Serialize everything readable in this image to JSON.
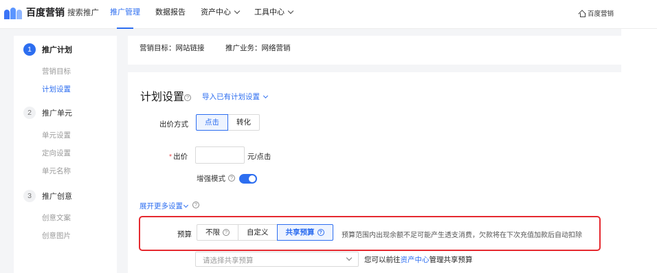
{
  "brand": {
    "name": "百度营销",
    "sub": "搜索推广"
  },
  "nav": {
    "items": [
      {
        "label": "推广管理",
        "active": true,
        "dropdown": false
      },
      {
        "label": "数据报告",
        "active": false,
        "dropdown": false
      },
      {
        "label": "资产中心",
        "active": false,
        "dropdown": true
      },
      {
        "label": "工具中心",
        "active": false,
        "dropdown": true
      }
    ],
    "home_label": "百度营销"
  },
  "steps": [
    {
      "num": "1",
      "title": "推广计划",
      "active": true,
      "subs": [
        "营销目标",
        "计划设置"
      ],
      "current_sub": "计划设置"
    },
    {
      "num": "2",
      "title": "推广单元",
      "active": false,
      "subs": [
        "单元设置",
        "定向设置",
        "单元名称"
      ]
    },
    {
      "num": "3",
      "title": "推广创意",
      "active": false,
      "subs": [
        "创意文案",
        "创意图片"
      ]
    }
  ],
  "summary": {
    "target": "营销目标：网站链接",
    "business": "推广业务：网络营销"
  },
  "plan": {
    "title": "计划设置",
    "import_link": "导入已有计划设置",
    "bid_mode_label": "出价方式",
    "bid_modes": [
      "点击",
      "转化"
    ],
    "bid_mode_selected": "点击",
    "bid_label": "出价",
    "bid_value": "",
    "bid_unit": "元/点击",
    "enhanced_label": "增强模式",
    "enhanced_on": true,
    "more_link": "展开更多设置",
    "budget_label": "预算",
    "budget_options": [
      "不限",
      "自定义",
      "共享预算"
    ],
    "budget_selected": "共享预算",
    "budget_note": "预算范围内出现余额不足可能产生透支消费，欠款将在下次充值加款后自动扣除",
    "shared_placeholder": "请选择共享预算",
    "shared_note_prefix": "您可以前往",
    "shared_note_link": "资产中心",
    "shared_note_suffix": "管理共享预算"
  },
  "colors": {
    "primary": "#2d6ef0",
    "danger": "#e5292f",
    "bg": "#f4f5f7"
  },
  "icons": [
    "question-circle-icon",
    "chevron-down-icon",
    "home-icon"
  ]
}
